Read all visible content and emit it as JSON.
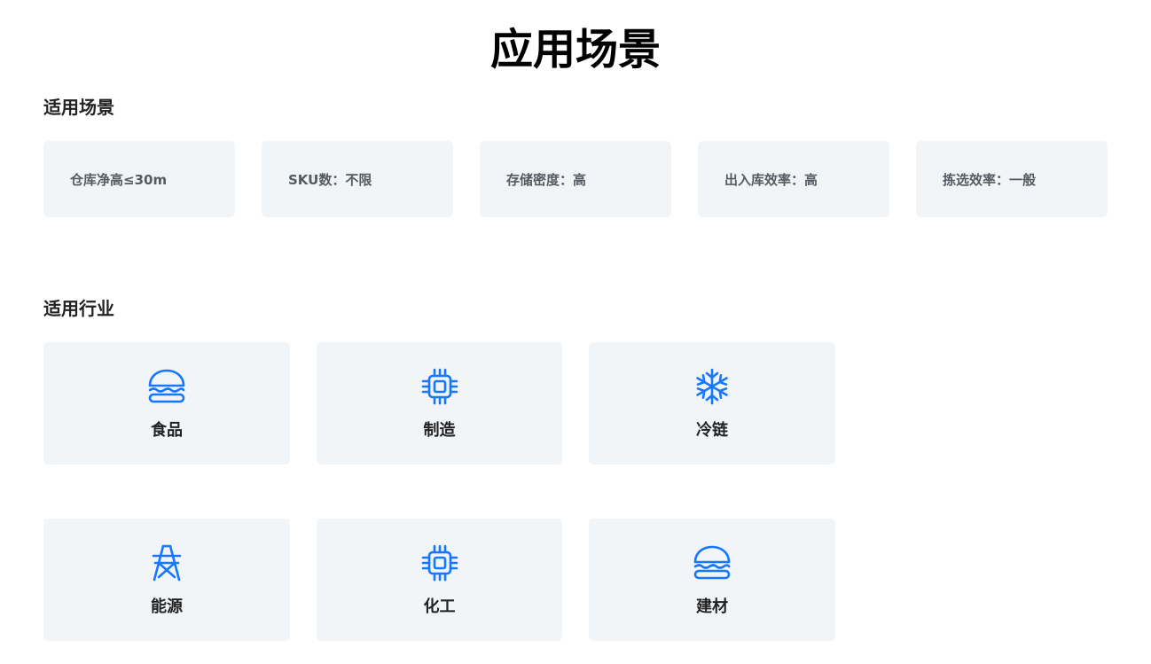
{
  "page": {
    "title": "应用场景"
  },
  "scenarios": {
    "title": "适用场景",
    "items": [
      {
        "label": "仓库净高≤30m"
      },
      {
        "label": "SKU数：不限"
      },
      {
        "label": "存储密度：高"
      },
      {
        "label": "出入库效率：高"
      },
      {
        "label": "拣选效率：一般"
      }
    ]
  },
  "industries": {
    "title": "适用行业",
    "icon_color": "#1677ff",
    "items": [
      {
        "label": "食品",
        "icon": "burger-icon"
      },
      {
        "label": "制造",
        "icon": "chip-icon"
      },
      {
        "label": "冷链",
        "icon": "snowflake-icon"
      },
      {
        "label": "能源",
        "icon": "power-tower-icon"
      },
      {
        "label": "化工",
        "icon": "chip-icon"
      },
      {
        "label": "建材",
        "icon": "burger-icon"
      }
    ]
  }
}
